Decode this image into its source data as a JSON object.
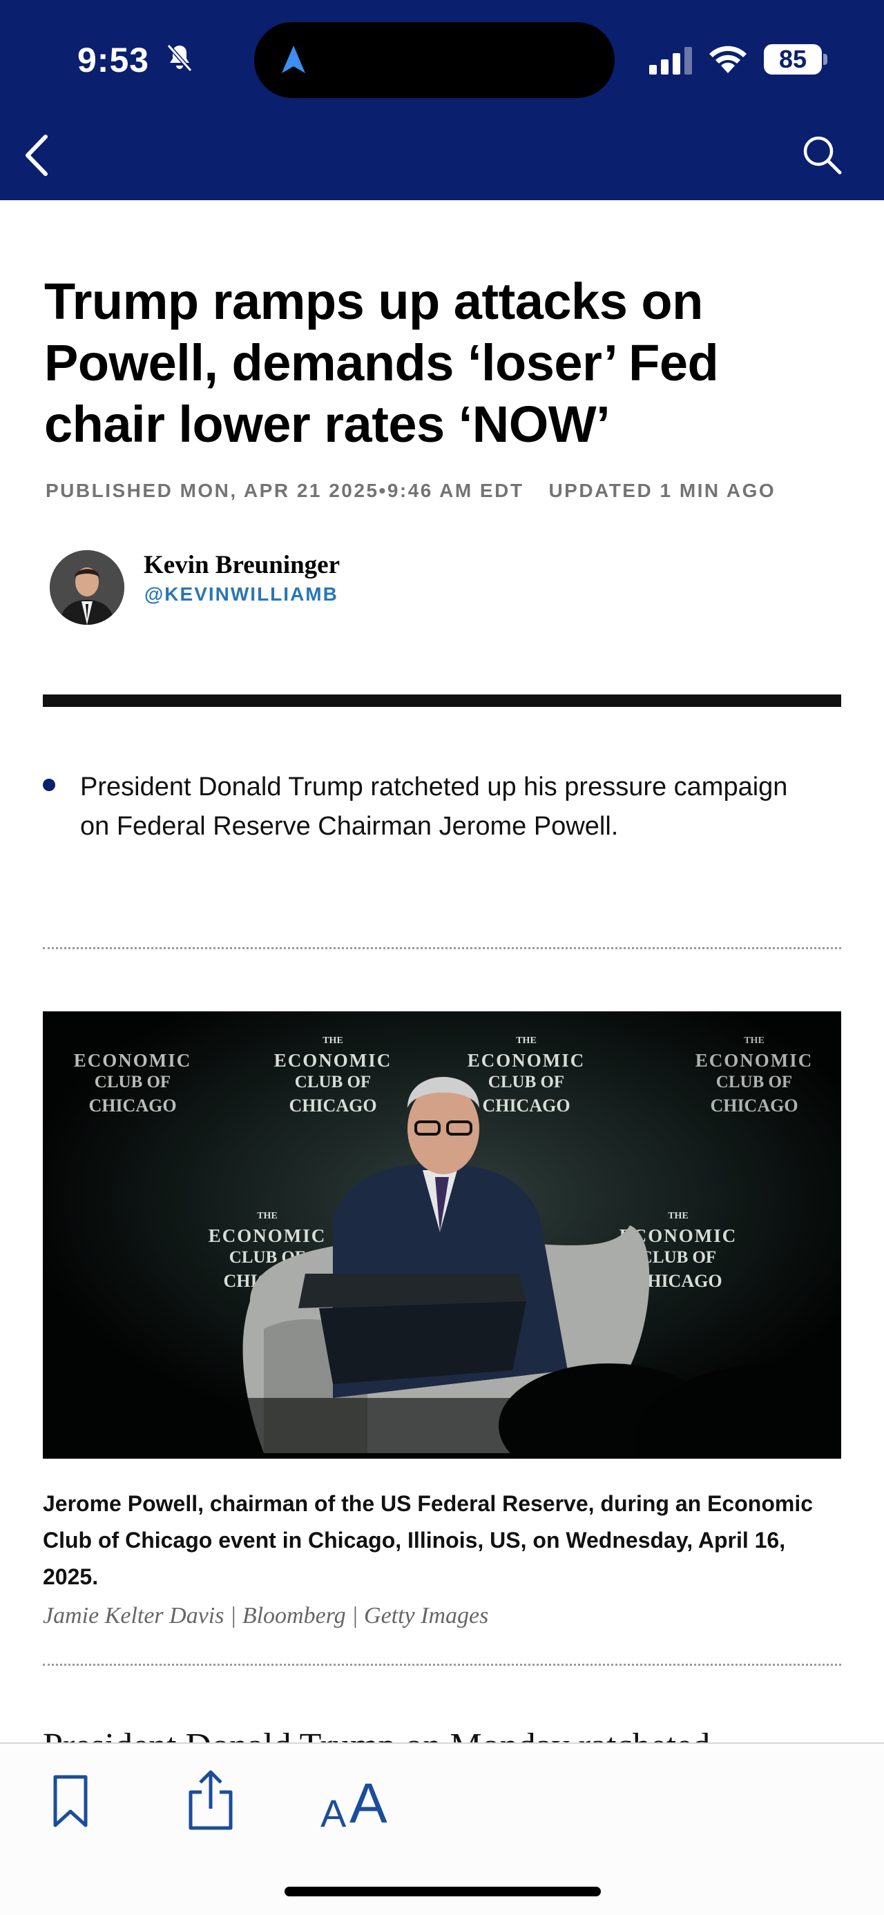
{
  "status_bar": {
    "time": "9:53",
    "battery": "85",
    "icons": [
      "bell-slash-icon",
      "location-arrow-icon",
      "signal-icon",
      "wifi-icon",
      "battery-icon"
    ]
  },
  "header": {
    "background": "#0a1f6e",
    "back_icon": "chevron-left-icon",
    "search_icon": "search-icon"
  },
  "article": {
    "headline": "Trump ramps up attacks on Powell, demands ‘loser’ Fed chair lower rates ‘NOW’",
    "published": "PUBLISHED MON, APR 21 2025•9:46 AM EDT",
    "updated": "UPDATED 1 MIN AGO",
    "author": {
      "name": "Kevin Breuninger",
      "handle": "@KEVINWILLIAMB"
    },
    "key_points": [
      "President Donald Trump ratcheted up his pressure campaign on Federal Reserve Chairman Jerome Powell."
    ],
    "image": {
      "backdrop_text": "THE ECONOMIC CLUB OF CHICAGO"
    },
    "caption": "Jerome Powell, chairman of the US Federal Reserve, during an Economic Club of Chicago event in Chicago, Illinois, US, on Wednesday, April 16, 2025.",
    "credit": "Jamie Kelter Davis | Bloomberg | Getty Images",
    "body_peek": "President Donald Trump on Monday ratcheted"
  },
  "toolbar": {
    "bookmark_icon": "bookmark-icon",
    "share_icon": "share-icon",
    "text_size_small": "A",
    "text_size_big": "A",
    "accent": "#1c4c9c"
  }
}
